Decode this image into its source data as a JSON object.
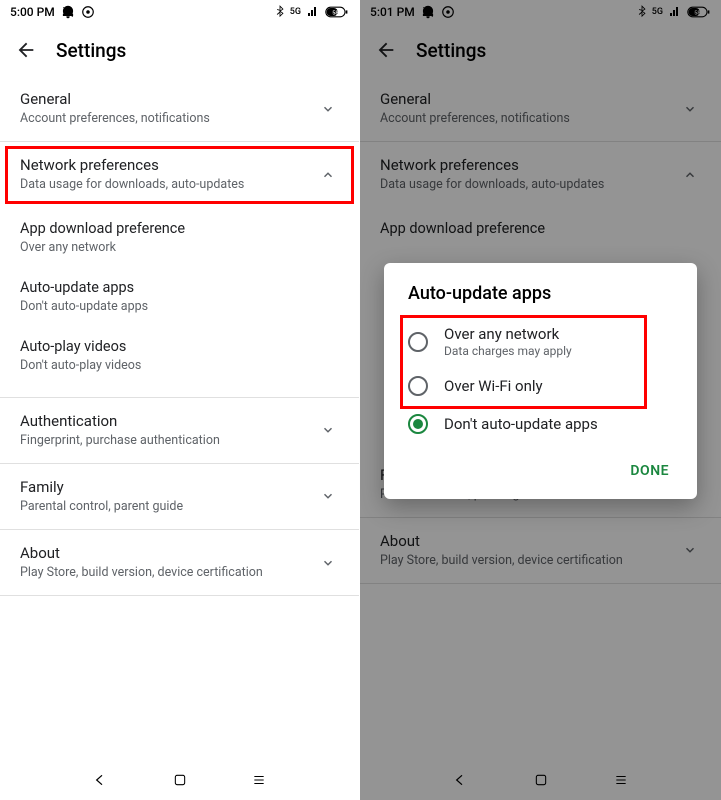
{
  "left": {
    "status_time": "5:00 PM",
    "header_title": "Settings",
    "sections": {
      "general": {
        "title": "General",
        "sub": "Account preferences, notifications"
      },
      "network": {
        "title": "Network preferences",
        "sub": "Data usage for downloads, auto-updates"
      },
      "app_dl": {
        "title": "App download preference",
        "sub": "Over any network"
      },
      "auto_update": {
        "title": "Auto-update apps",
        "sub": "Don't auto-update apps"
      },
      "auto_play": {
        "title": "Auto-play videos",
        "sub": "Don't auto-play videos"
      },
      "auth": {
        "title": "Authentication",
        "sub": "Fingerprint, purchase authentication"
      },
      "family": {
        "title": "Family",
        "sub": "Parental control, parent guide"
      },
      "about": {
        "title": "About",
        "sub": "Play Store, build version, device certification"
      }
    }
  },
  "right": {
    "status_time": "5:01 PM",
    "header_title": "Settings",
    "sections": {
      "general": {
        "title": "General",
        "sub": "Account preferences, notifications"
      },
      "network": {
        "title": "Network preferences",
        "sub": "Data usage for downloads, auto-updates"
      },
      "app_dl": {
        "title": "App download preference"
      },
      "family": {
        "title": "Family",
        "sub": "Parental control, parent guide"
      },
      "about": {
        "title": "About",
        "sub": "Play Store, build version, device certification"
      }
    },
    "dialog": {
      "title": "Auto-update apps",
      "opt1": {
        "title": "Over any network",
        "sub": "Data charges may apply"
      },
      "opt2": {
        "title": "Over Wi-Fi only"
      },
      "opt3": {
        "title": "Don't auto-update apps"
      },
      "done": "DONE"
    }
  },
  "status_net": "5G",
  "status_battery": "58"
}
